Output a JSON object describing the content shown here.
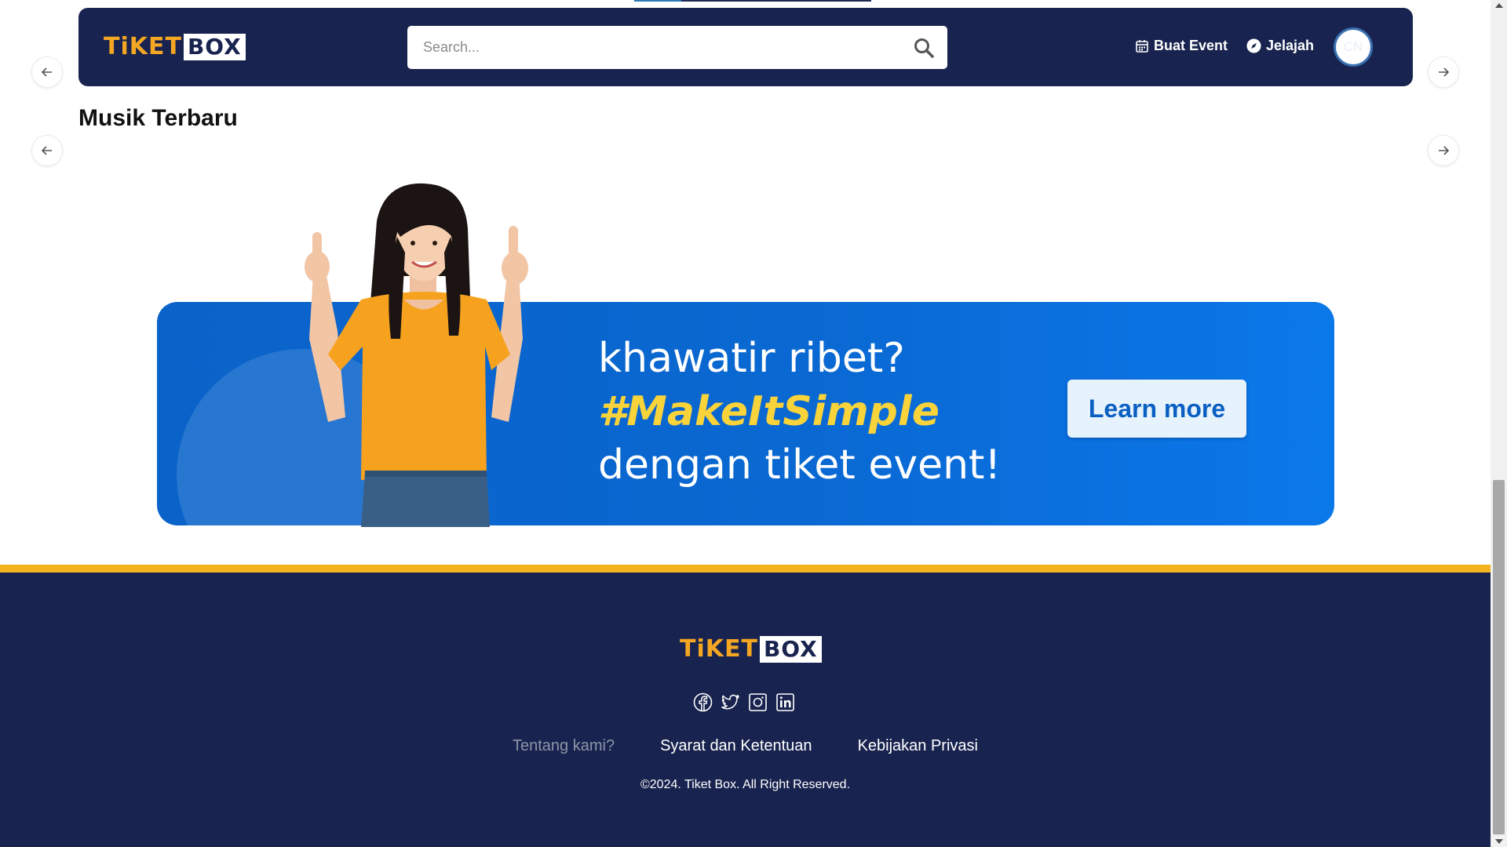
{
  "brand": {
    "logo_left": "TiKET",
    "logo_right": "BOX",
    "accent": "#f5a623",
    "navy": "#18244f"
  },
  "navbar": {
    "search_placeholder": "Search...",
    "buat_event": "Buat Event",
    "jelajah": "Jelajah",
    "avatar_initials": "CN"
  },
  "section": {
    "title": "Musik Terbaru"
  },
  "banner": {
    "line1": "khawatir ribet?",
    "line2": "#MakeItSimple",
    "line3": "dengan tiket event!",
    "cta": "Learn more",
    "bg": "#0a68d2",
    "highlight": "#f9d33a"
  },
  "footer": {
    "socials": [
      "facebook-icon",
      "twitter-icon",
      "instagram-icon",
      "linkedin-icon"
    ],
    "links": [
      "Tentang kami?",
      "Syarat dan Ketentuan",
      "Kebijakan Privasi"
    ],
    "copyright": "©2024. Tiket Box. All Right Reserved.",
    "bar_color": "#f2b31c"
  }
}
